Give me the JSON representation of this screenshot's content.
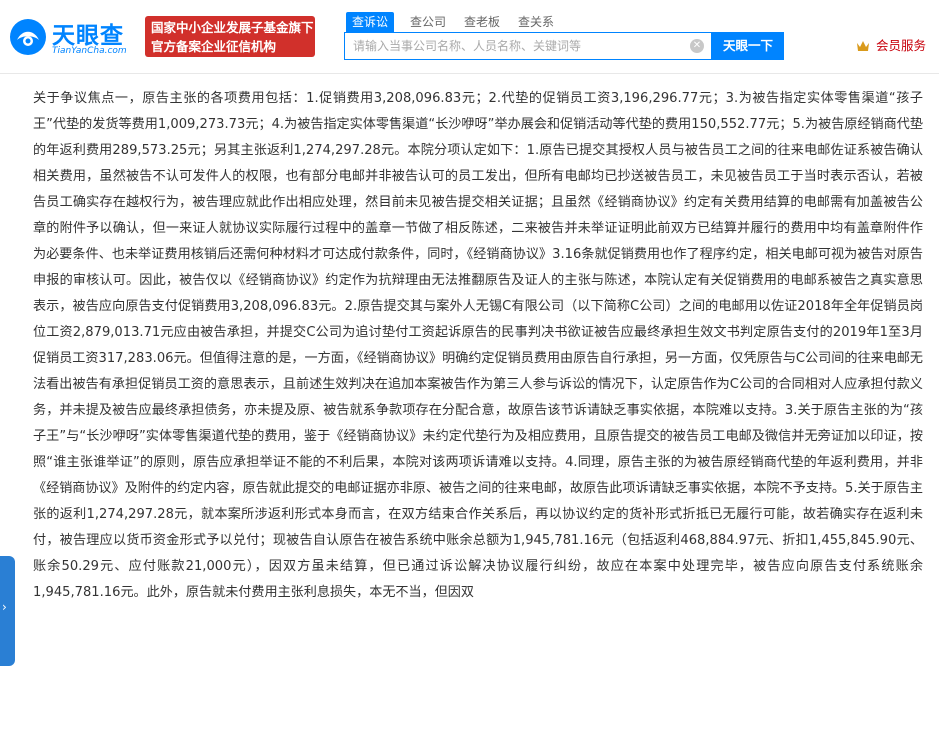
{
  "header": {
    "logo_text": "天眼查",
    "logo_subtext": "TianYanCha.com",
    "badge_line1": "国家中小企业发展子基金旗下",
    "badge_line2": "官方备案企业征信机构",
    "tabs": [
      {
        "label": "查诉讼",
        "active": true
      },
      {
        "label": "查公司",
        "active": false
      },
      {
        "label": "查老板",
        "active": false
      },
      {
        "label": "查关系",
        "active": false
      }
    ],
    "search_placeholder": "请输入当事公司名称、人员名称、关键词等",
    "search_button": "天眼一下",
    "member_label": "会员服务"
  },
  "content": {
    "paragraph": "关于争议焦点一，原告主张的各项费用包括：1.促销费用3,208,096.83元；2.代垫的促销员工资3,196,296.77元；3.为被告指定实体零售渠道“孩子王”代垫的发货等费用1,009,273.73元；4.为被告指定实体零售渠道“长沙咿呀”举办展会和促销活动等代垫的费用150,552.77元；5.为被告原经销商代垫的年返利费用289,573.25元；另其主张返利1,274,297.28元。本院分项认定如下：1.原告已提交其授权人员与被告员工之间的往来电邮佐证系被告确认相关费用，虽然被告不认可发件人的权限，也有部分电邮并非被告认可的员工发出，但所有电邮均已抄送被告员工，未见被告员工于当时表示否认，若被告员工确实存在越权行为，被告理应就此作出相应处理，然目前未见被告提交相关证据；且虽然《经销商协议》约定有关费用结算的电邮需有加盖被告公章的附件予以确认，但一来证人就协议实际履行过程中的盖章一节做了相反陈述，二来被告并未举证证明此前双方已结算并履行的费用中均有盖章附件作为必要条件、也未举证费用核销后还需何种材料才可达成付款条件，同时，《经销商协议》3.16条就促销费用也作了程序约定，相关电邮可视为被告对原告申报的审核认可。因此，被告仅以《经销商协议》约定作为抗辩理由无法推翻原告及证人的主张与陈述，本院认定有关促销费用的电邮系被告之真实意思表示，被告应向原告支付促销费用3,208,096.83元。2.原告提交其与案外人无锡C有限公司（以下简称C公司）之间的电邮用以佐证2018年全年促销员岗位工资2,879,013.71元应由被告承担，并提交C公司为追讨垫付工资起诉原告的民事判决书欲证被告应最终承担生效文书判定原告支付的2019年1至3月促销员工资317,283.06元。但值得注意的是，一方面，《经销商协议》明确约定促销员费用由原告自行承担，另一方面，仅凭原告与C公司间的往来电邮无法看出被告有承担促销员工资的意思表示，且前述生效判决在追加本案被告作为第三人参与诉讼的情况下，认定原告作为C公司的合同相对人应承担付款义务，并未提及被告应最终承担债务，亦未提及原、被告就系争款项存在分配合意，故原告该节诉请缺乏事实依据，本院难以支持。3.关于原告主张的为“孩子王”与“长沙咿呀”实体零售渠道代垫的费用，鉴于《经销商协议》未约定代垫行为及相应费用，且原告提交的被告员工电邮及微信并无旁证加以印证，按照“谁主张谁举证”的原则，原告应承担举证不能的不利后果，本院对该两项诉请难以支持。4.同理，原告主张的为被告原经销商代垫的年返利费用，并非《经销商协议》及附件的约定内容，原告就此提交的电邮证据亦非原、被告之间的往来电邮，故原告此项诉请缺乏事实依据，本院不予支持。5.关于原告主张的返利1,274,297.28元，就本案所涉返利形式本身而言，在双方结束合作关系后，再以协议约定的货补形式折抵已无履行可能，故若确实存在返利未付，被告理应以货币资金形式予以兑付；现被告自认原告在被告系统中账余总额为1,945,781.16元（包括返利468,884.97元、折扣1,455,845.90元、账余50.29元、应付账款21,000元），因双方虽未结算，但已通过诉讼解决协议履行纠纷，故应在本案中处理完毕，被告应向原告支付系统账余1,945,781.16元。此外，原告就未付费用主张利息损失，本无不当，但因双"
  },
  "colors": {
    "brand_blue": "#0084ff",
    "badge_red": "#d1302b",
    "member_red": "#c7000b"
  }
}
